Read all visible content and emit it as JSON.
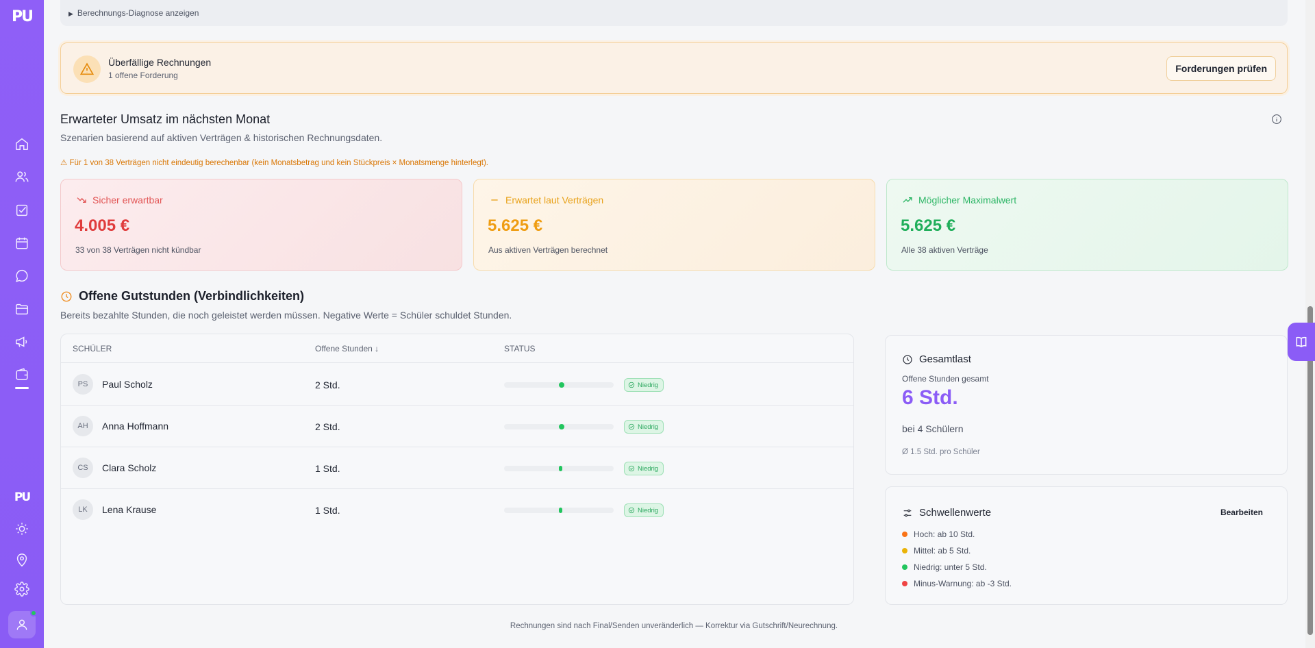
{
  "sidebar": {
    "logo": "PU",
    "logo_small": "PU"
  },
  "diagnostics": {
    "toggle_label": "Berechnungs-Diagnose anzeigen"
  },
  "overdue": {
    "title": "Überfällige Rechnungen",
    "subtitle": "1 offene Forderung",
    "button": "Forderungen prüfen"
  },
  "revenue": {
    "title": "Erwarteter Umsatz im nächsten Monat",
    "subtitle": "Szenarien basierend auf aktiven Verträgen & historischen Rechnungsdaten.",
    "warning": "⚠ Für 1 von 38 Verträgen nicht eindeutig berechenbar (kein Monatsbetrag und kein Stückpreis × Monatsmenge hinterlegt).",
    "cards": [
      {
        "label": "Sicher erwartbar",
        "value": "4.005 €",
        "note": "33 von 38 Verträgen nicht kündbar",
        "color": "#e03c3c"
      },
      {
        "label": "Erwartet laut Verträgen",
        "value": "5.625 €",
        "note": "Aus aktiven Verträgen berechnet",
        "color": "#ef9d12"
      },
      {
        "label": "Möglicher Maximalwert",
        "value": "5.625 €",
        "note": "Alle 38 aktiven Verträge",
        "color": "#1fae5a"
      }
    ]
  },
  "credits": {
    "title": "Offene Gutstunden (Verbindlichkeiten)",
    "subtitle": "Bereits bezahlte Stunden, die noch geleistet werden müssen. Negative Werte = Schüler schuldet Stunden.",
    "columns": {
      "student": "SCHÜLER",
      "hours": "Offene Stunden ↓",
      "status": "STATUS"
    },
    "rows": [
      {
        "initials": "PS",
        "name": "Paul Scholz",
        "hours": "2 Std.",
        "status": "Niedrig",
        "level": 0.05
      },
      {
        "initials": "AH",
        "name": "Anna Hoffmann",
        "hours": "2 Std.",
        "status": "Niedrig",
        "level": 0.05
      },
      {
        "initials": "CS",
        "name": "Clara Scholz",
        "hours": "1 Std.",
        "status": "Niedrig",
        "level": 0.025
      },
      {
        "initials": "LK",
        "name": "Lena Krause",
        "hours": "1 Std.",
        "status": "Niedrig",
        "level": 0.025
      }
    ]
  },
  "total": {
    "title": "Gesamtlast",
    "label": "Offene Stunden gesamt",
    "value": "6 Std.",
    "students": "bei 4 Schülern",
    "average": "Ø 1.5 Std. pro Schüler",
    "value_color": "#8b5cf6"
  },
  "thresholds": {
    "title": "Schwellenwerte",
    "edit": "Bearbeiten",
    "items": [
      {
        "label": "Hoch: ab 10 Std.",
        "color": "#f97316"
      },
      {
        "label": "Mittel: ab 5 Std.",
        "color": "#eab308"
      },
      {
        "label": "Niedrig: unter 5 Std.",
        "color": "#22c55e"
      },
      {
        "label": "Minus-Warnung: ab -3 Std.",
        "color": "#ef4444"
      }
    ]
  },
  "footer": "Rechnungen sind nach Final/Senden unveränderlich — Korrektur via Gutschrift/Neurechnung."
}
